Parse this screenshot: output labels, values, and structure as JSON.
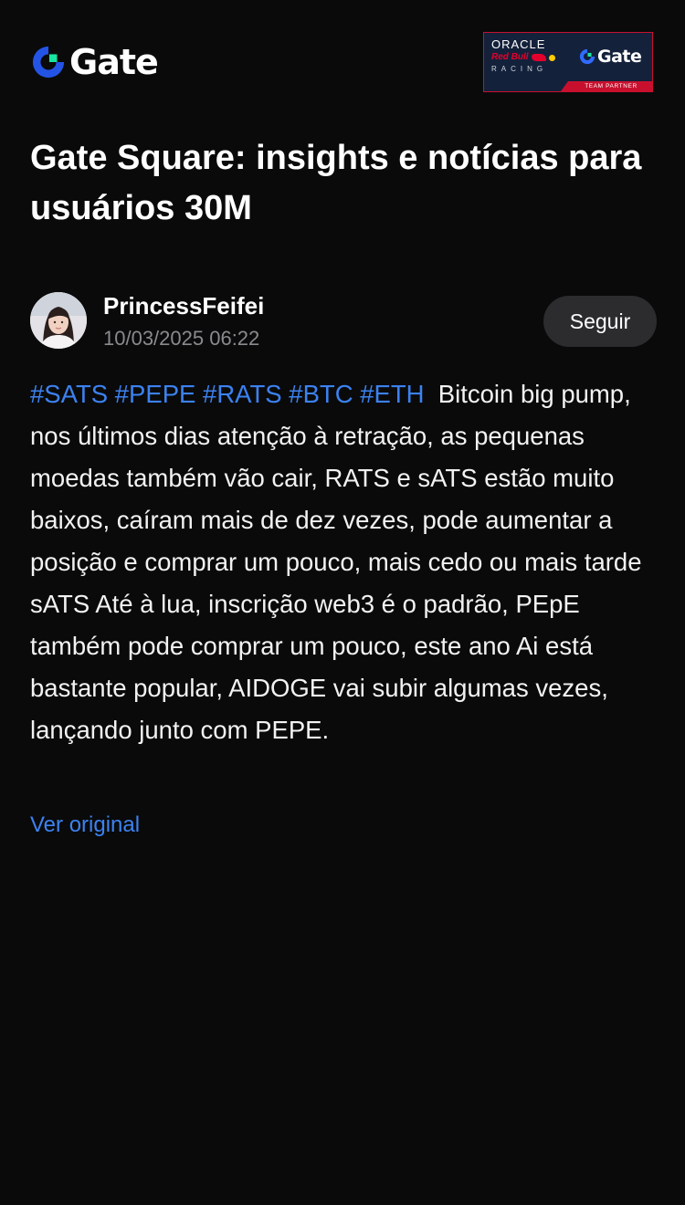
{
  "header": {
    "logo_text": "Gate",
    "partner_banner": {
      "oracle": "ORACLE",
      "redbull": "Red Bull",
      "racing": "RACING",
      "gate_text": "Gate",
      "team_partner": "TEAM PARTNER"
    }
  },
  "page": {
    "title": "Gate Square: insights e notícias para usuários 30M"
  },
  "post": {
    "author_name": "PrincessFeifei",
    "date": "10/03/2025 06:22",
    "follow_label": "Seguir",
    "tags": [
      "#SATS",
      "#PEPE",
      "#RATS",
      "#BTC",
      "#ETH"
    ],
    "body": "Bitcoin big pump, nos últimos dias atenção à retração, as pequenas moedas também vão cair, RATS e sATS estão muito baixos, caíram mais de dez vezes, pode aumentar a posição e comprar um pouco, mais cedo ou mais tarde sATS Até à lua, inscrição web3 é o padrão, PEpE também pode comprar um pouco, este ano Ai está bastante popular, AIDOGE vai subir algumas vezes, lançando junto com PEPE.",
    "view_original_label": "Ver original"
  },
  "colors": {
    "background": "#0a0a0b",
    "accent_blue": "#3c82f0",
    "logo_blue": "#2354e6",
    "logo_green": "#17e5a1",
    "follow_button_bg": "#2c2c2e",
    "muted_text": "#8a8a8e"
  },
  "icons": {
    "brand_logo": "gate-logo-icon"
  }
}
